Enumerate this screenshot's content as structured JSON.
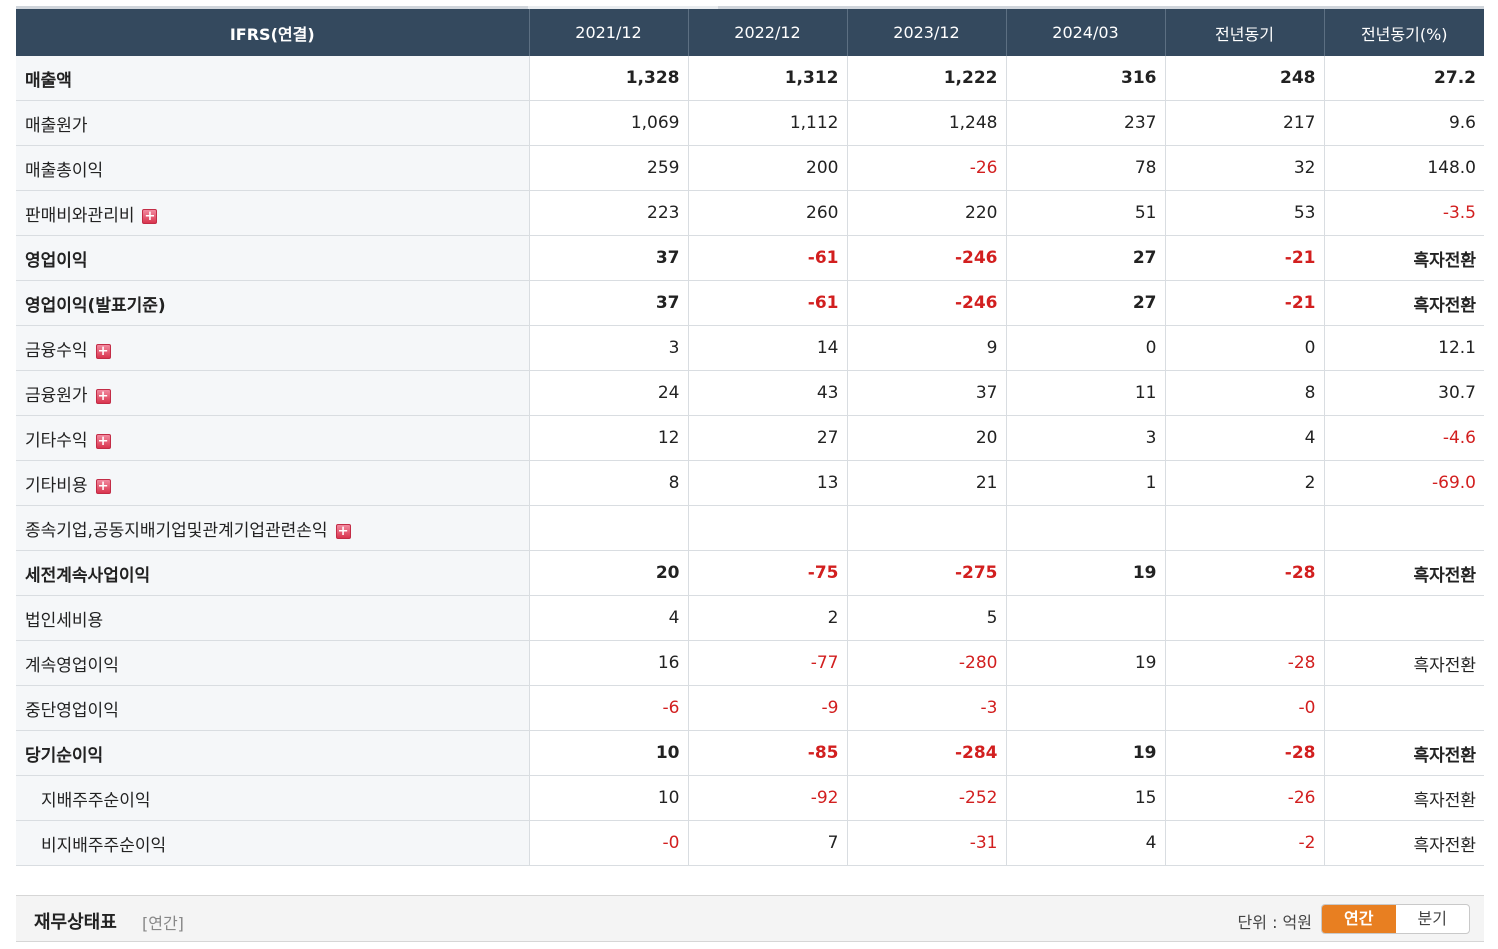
{
  "table": {
    "header": [
      "IFRS(연결)",
      "2021/12",
      "2022/12",
      "2023/12",
      "2024/03",
      "전년동기",
      "전년동기(%)"
    ],
    "rows": [
      {
        "label": "매출액",
        "bold": true,
        "sub": false,
        "expand": false,
        "sep": false,
        "values": [
          "1,328",
          "1,312",
          "1,222",
          "316",
          "248",
          "27.2"
        ]
      },
      {
        "label": "매출원가",
        "bold": false,
        "sub": false,
        "expand": false,
        "sep": false,
        "values": [
          "1,069",
          "1,112",
          "1,248",
          "237",
          "217",
          "9.6"
        ]
      },
      {
        "label": "매출총이익",
        "bold": false,
        "sub": false,
        "expand": false,
        "sep": false,
        "values": [
          "259",
          "200",
          "-26",
          "78",
          "32",
          "148.0"
        ]
      },
      {
        "label": "판매비와관리비",
        "bold": false,
        "sub": false,
        "expand": true,
        "sep": false,
        "values": [
          "223",
          "260",
          "220",
          "51",
          "53",
          "-3.5"
        ]
      },
      {
        "label": "영업이익",
        "bold": true,
        "sub": false,
        "expand": false,
        "sep": true,
        "values": [
          "37",
          "-61",
          "-246",
          "27",
          "-21",
          "흑자전환"
        ]
      },
      {
        "label": "영업이익(발표기준)",
        "bold": true,
        "sub": false,
        "expand": false,
        "sep": false,
        "values": [
          "37",
          "-61",
          "-246",
          "27",
          "-21",
          "흑자전환"
        ]
      },
      {
        "label": "금융수익",
        "bold": false,
        "sub": false,
        "expand": true,
        "sep": false,
        "values": [
          "3",
          "14",
          "9",
          "0",
          "0",
          "12.1"
        ]
      },
      {
        "label": "금융원가",
        "bold": false,
        "sub": false,
        "expand": true,
        "sep": false,
        "values": [
          "24",
          "43",
          "37",
          "11",
          "8",
          "30.7"
        ]
      },
      {
        "label": "기타수익",
        "bold": false,
        "sub": false,
        "expand": true,
        "sep": false,
        "values": [
          "12",
          "27",
          "20",
          "3",
          "4",
          "-4.6"
        ]
      },
      {
        "label": "기타비용",
        "bold": false,
        "sub": false,
        "expand": true,
        "sep": false,
        "values": [
          "8",
          "13",
          "21",
          "1",
          "2",
          "-69.0"
        ]
      },
      {
        "label": "종속기업,공동지배기업및관계기업관련손익",
        "bold": false,
        "sub": false,
        "expand": true,
        "sep": false,
        "values": [
          "",
          "",
          "",
          "",
          "",
          ""
        ]
      },
      {
        "label": "세전계속사업이익",
        "bold": true,
        "sub": false,
        "expand": false,
        "sep": true,
        "values": [
          "20",
          "-75",
          "-275",
          "19",
          "-28",
          "흑자전환"
        ]
      },
      {
        "label": "법인세비용",
        "bold": false,
        "sub": false,
        "expand": false,
        "sep": false,
        "values": [
          "4",
          "2",
          "5",
          "",
          "",
          ""
        ]
      },
      {
        "label": "계속영업이익",
        "bold": false,
        "sub": false,
        "expand": false,
        "sep": false,
        "values": [
          "16",
          "-77",
          "-280",
          "19",
          "-28",
          "흑자전환"
        ]
      },
      {
        "label": "중단영업이익",
        "bold": false,
        "sub": false,
        "expand": false,
        "sep": false,
        "values": [
          "-6",
          "-9",
          "-3",
          "",
          "-0",
          ""
        ]
      },
      {
        "label": "당기순이익",
        "bold": true,
        "sub": false,
        "expand": false,
        "sep": false,
        "values": [
          "10",
          "-85",
          "-284",
          "19",
          "-28",
          "흑자전환"
        ]
      },
      {
        "label": "지배주주순이익",
        "bold": false,
        "sub": true,
        "expand": false,
        "sep": false,
        "values": [
          "10",
          "-92",
          "-252",
          "15",
          "-26",
          "흑자전환"
        ]
      },
      {
        "label": "비지배주주순이익",
        "bold": false,
        "sub": true,
        "expand": false,
        "sep": false,
        "values": [
          "-0",
          "7",
          "-31",
          "4",
          "-2",
          "흑자전환"
        ]
      }
    ]
  },
  "expand_icon": {
    "name": "plus-icon",
    "glyph": "+"
  },
  "footer": {
    "title": "재무상태표",
    "title_sub": "[연간]",
    "unit": "단위 : 억원",
    "toggle": [
      "연간",
      "분기"
    ],
    "active_toggle": "연간"
  },
  "colors": {
    "header_bg": "#34495e",
    "negative": "#d21f1f",
    "accent": "#e87f21",
    "label_bg": "#f5f7f9"
  }
}
